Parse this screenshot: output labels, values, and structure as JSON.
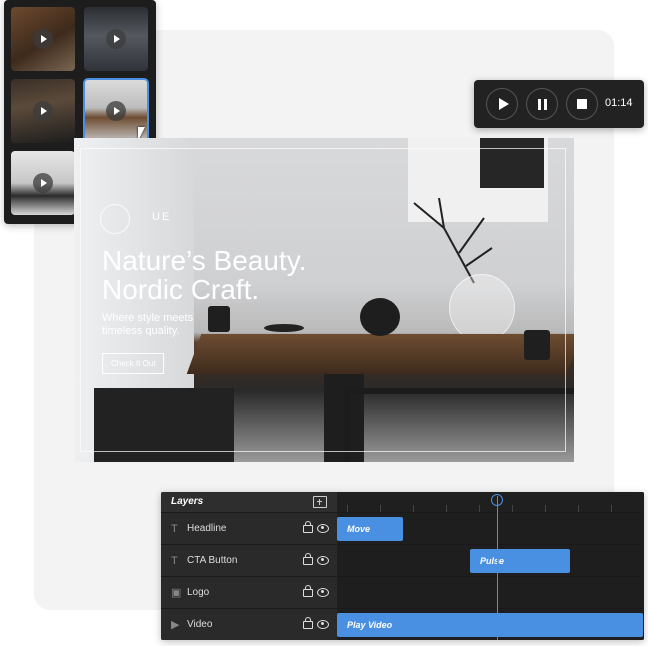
{
  "player": {
    "time": "01:14"
  },
  "hero": {
    "brand": "UE",
    "headline_line1": "Nature’s Beauty.",
    "headline_line2": "Nordic Craft.",
    "sub_line1": "Where style meets",
    "sub_line2": "timeless quality.",
    "cta_label": "Check It Out"
  },
  "timeline": {
    "header": "Layers",
    "layers": [
      {
        "name": "Headline",
        "type": "text",
        "type_glyph": "T",
        "clip": "Move"
      },
      {
        "name": "CTA Button",
        "type": "text",
        "type_glyph": "T",
        "clip": "Pulse"
      },
      {
        "name": "Logo",
        "type": "image",
        "type_glyph": "▣",
        "clip": ""
      },
      {
        "name": "Video",
        "type": "video",
        "type_glyph": "▶",
        "clip": "Play Video"
      }
    ]
  },
  "colors": {
    "accent": "#4a90e2",
    "panel": "#252525",
    "backdrop": "#f3f3f3"
  }
}
